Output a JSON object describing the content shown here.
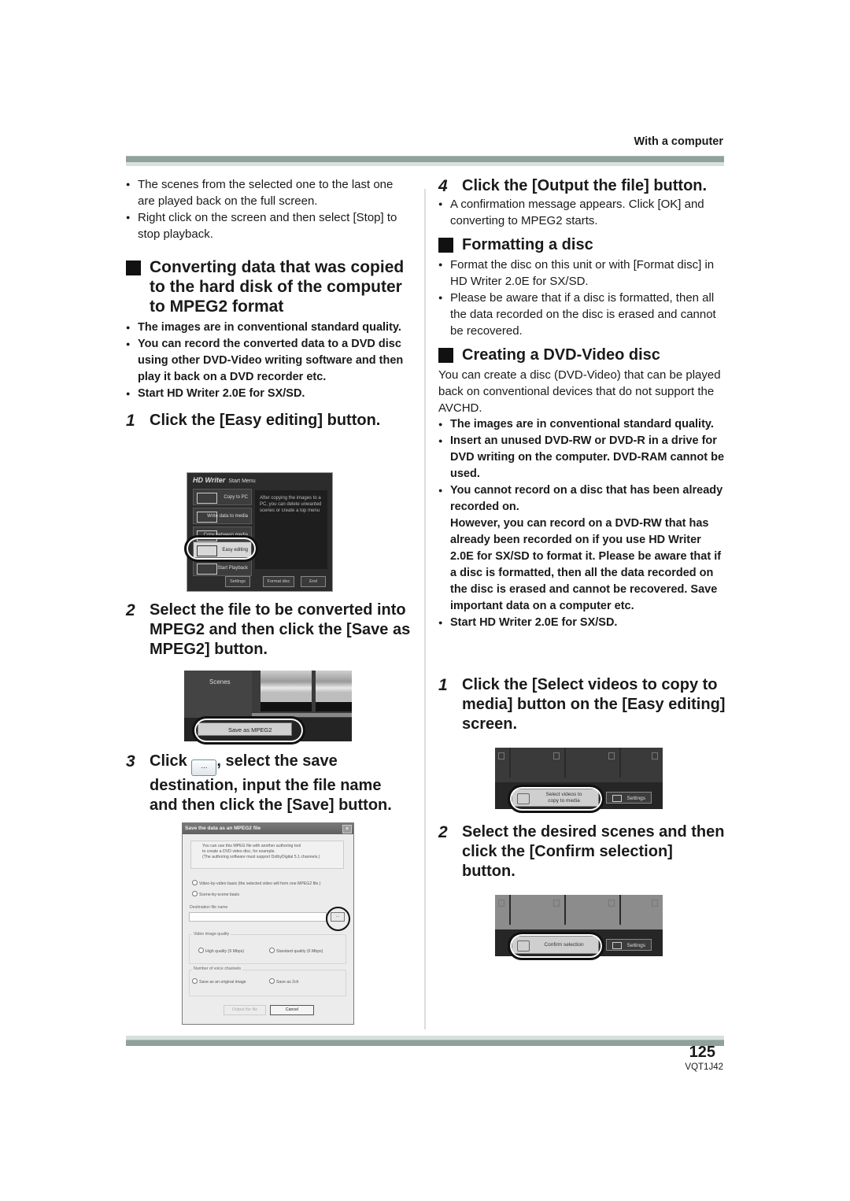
{
  "header": {
    "section_label": "With a computer"
  },
  "left": {
    "intro_bullets": [
      "The scenes from the selected one to the last one are played back on the full screen.",
      "Right click on the screen and then select [Stop] to stop playback."
    ],
    "section_title": "Converting data that was copied to the hard disk of the computer to MPEG2 format",
    "notes": [
      "The images are in conventional standard quality.",
      "You can record the converted data to a DVD disc using other DVD-Video writing software and then play it back on a DVD recorder etc.",
      "Start HD Writer 2.0E for SX/SD."
    ],
    "steps": [
      {
        "num": "1",
        "text": "Click the [Easy editing] button."
      },
      {
        "num": "2",
        "text": "Select the file to be converted into MPEG2 and then click the [Save as MPEG2] button."
      },
      {
        "num": "3",
        "text_before": "Click",
        "inline_button": "...",
        "text_after": ", select the save destination, input the file name and then click the [Save] button."
      }
    ],
    "start_menu_screenshot": {
      "title": "HD Writer",
      "subtitle": "Start Menu",
      "menu_items": [
        "Copy to PC",
        "Write data to media",
        "Copy between media",
        "Easy editing",
        "Start Playback"
      ],
      "selected_item": "Easy editing",
      "info_text": "After copying the images to a PC, you can delete unwanted scenes or create a top menu",
      "footer_buttons": [
        "Settings",
        "Format disc",
        "End"
      ]
    },
    "scenes_screenshot": {
      "side_label": "Scenes",
      "button_label": "Save as MPEG2"
    },
    "save_dialog_screenshot": {
      "title": "Save the data as an MPEG2 file",
      "info_lines": [
        "You can use this MPEG file with another authoring tool",
        "to create a DVD video disc, for example.",
        "(The authoring software must support DolbyDigital 5.1 channels.)"
      ],
      "radio_basis": [
        "Video-by-video basis (the selected video will form one MPEG2 file.)",
        "Scene-by-scene basis"
      ],
      "destination_label": "Destination file name",
      "destination_value": "",
      "browse_label": "...",
      "quality_group_label": "Video image quality",
      "quality_options": [
        "High quality (9 Mbps)",
        "Standard quality (6 Mbps)"
      ],
      "channels_group_label": "Number of voice channels",
      "channel_options": [
        "Save as an original image",
        "Save as 2ch"
      ],
      "buttons": [
        "Output the file",
        "Cancel"
      ]
    }
  },
  "right": {
    "step4": {
      "num": "4",
      "text": "Click the [Output the file] button."
    },
    "step4_bullets": [
      "A confirmation message appears. Click [OK] and converting to MPEG2 starts."
    ],
    "format_title": "Formatting a disc",
    "format_bullets": [
      "Format the disc on this unit or with [Format disc] in HD Writer 2.0E for SX/SD.",
      "Please be aware that if a disc is formatted, then all the data recorded on the disc is erased and cannot be recovered."
    ],
    "dvd_title": "Creating a DVD-Video disc",
    "dvd_intro": "You can create a disc (DVD-Video) that can be played back on conventional devices that do not support the AVCHD.",
    "dvd_notes": [
      "The images are in conventional standard quality.",
      "Insert an unused DVD-RW or DVD-R in a drive for DVD writing on the computer. DVD-RAM cannot be used.",
      "You cannot record on a disc that has been already recorded on."
    ],
    "dvd_note_continuation": "However, you can record on a DVD-RW that has already been recorded on if you use HD Writer 2.0E for SX/SD to format it. Please be aware that if a disc is formatted, then all the data recorded on the disc is erased and cannot be recovered. Save important data on a computer etc.",
    "dvd_last_note": "Start HD Writer 2.0E for SX/SD.",
    "steps": [
      {
        "num": "1",
        "text": "Click the [Select videos to copy to media] button on the [Easy editing] screen."
      },
      {
        "num": "2",
        "text": "Select the desired scenes and then click the [Confirm selection] button."
      }
    ],
    "select_screenshot": {
      "button_label": "Select videos to copy to media",
      "settings_label": "Settings"
    },
    "confirm_screenshot": {
      "button_label": "Confirm selection",
      "settings_label": "Settings"
    }
  },
  "footer": {
    "page_number": "125",
    "doc_code": "VQT1J42"
  }
}
